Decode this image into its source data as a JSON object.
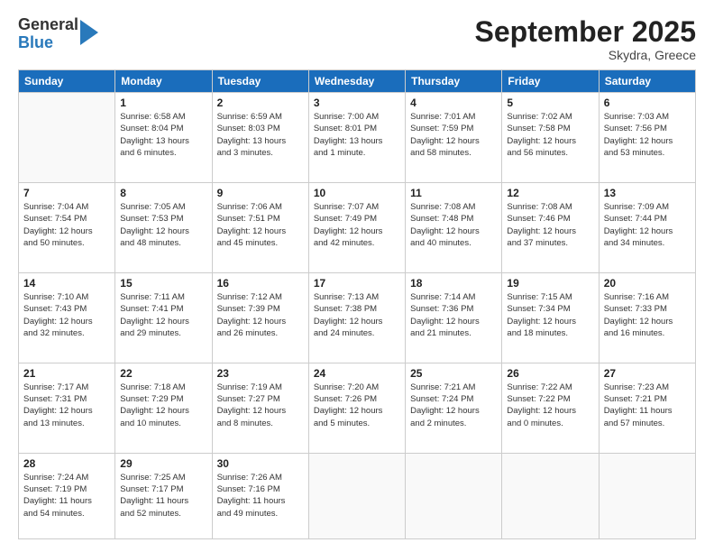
{
  "logo": {
    "general": "General",
    "blue": "Blue"
  },
  "title": "September 2025",
  "subtitle": "Skydra, Greece",
  "headers": [
    "Sunday",
    "Monday",
    "Tuesday",
    "Wednesday",
    "Thursday",
    "Friday",
    "Saturday"
  ],
  "weeks": [
    [
      {
        "day": "",
        "info": ""
      },
      {
        "day": "1",
        "info": "Sunrise: 6:58 AM\nSunset: 8:04 PM\nDaylight: 13 hours\nand 6 minutes."
      },
      {
        "day": "2",
        "info": "Sunrise: 6:59 AM\nSunset: 8:03 PM\nDaylight: 13 hours\nand 3 minutes."
      },
      {
        "day": "3",
        "info": "Sunrise: 7:00 AM\nSunset: 8:01 PM\nDaylight: 13 hours\nand 1 minute."
      },
      {
        "day": "4",
        "info": "Sunrise: 7:01 AM\nSunset: 7:59 PM\nDaylight: 12 hours\nand 58 minutes."
      },
      {
        "day": "5",
        "info": "Sunrise: 7:02 AM\nSunset: 7:58 PM\nDaylight: 12 hours\nand 56 minutes."
      },
      {
        "day": "6",
        "info": "Sunrise: 7:03 AM\nSunset: 7:56 PM\nDaylight: 12 hours\nand 53 minutes."
      }
    ],
    [
      {
        "day": "7",
        "info": "Sunrise: 7:04 AM\nSunset: 7:54 PM\nDaylight: 12 hours\nand 50 minutes."
      },
      {
        "day": "8",
        "info": "Sunrise: 7:05 AM\nSunset: 7:53 PM\nDaylight: 12 hours\nand 48 minutes."
      },
      {
        "day": "9",
        "info": "Sunrise: 7:06 AM\nSunset: 7:51 PM\nDaylight: 12 hours\nand 45 minutes."
      },
      {
        "day": "10",
        "info": "Sunrise: 7:07 AM\nSunset: 7:49 PM\nDaylight: 12 hours\nand 42 minutes."
      },
      {
        "day": "11",
        "info": "Sunrise: 7:08 AM\nSunset: 7:48 PM\nDaylight: 12 hours\nand 40 minutes."
      },
      {
        "day": "12",
        "info": "Sunrise: 7:08 AM\nSunset: 7:46 PM\nDaylight: 12 hours\nand 37 minutes."
      },
      {
        "day": "13",
        "info": "Sunrise: 7:09 AM\nSunset: 7:44 PM\nDaylight: 12 hours\nand 34 minutes."
      }
    ],
    [
      {
        "day": "14",
        "info": "Sunrise: 7:10 AM\nSunset: 7:43 PM\nDaylight: 12 hours\nand 32 minutes."
      },
      {
        "day": "15",
        "info": "Sunrise: 7:11 AM\nSunset: 7:41 PM\nDaylight: 12 hours\nand 29 minutes."
      },
      {
        "day": "16",
        "info": "Sunrise: 7:12 AM\nSunset: 7:39 PM\nDaylight: 12 hours\nand 26 minutes."
      },
      {
        "day": "17",
        "info": "Sunrise: 7:13 AM\nSunset: 7:38 PM\nDaylight: 12 hours\nand 24 minutes."
      },
      {
        "day": "18",
        "info": "Sunrise: 7:14 AM\nSunset: 7:36 PM\nDaylight: 12 hours\nand 21 minutes."
      },
      {
        "day": "19",
        "info": "Sunrise: 7:15 AM\nSunset: 7:34 PM\nDaylight: 12 hours\nand 18 minutes."
      },
      {
        "day": "20",
        "info": "Sunrise: 7:16 AM\nSunset: 7:33 PM\nDaylight: 12 hours\nand 16 minutes."
      }
    ],
    [
      {
        "day": "21",
        "info": "Sunrise: 7:17 AM\nSunset: 7:31 PM\nDaylight: 12 hours\nand 13 minutes."
      },
      {
        "day": "22",
        "info": "Sunrise: 7:18 AM\nSunset: 7:29 PM\nDaylight: 12 hours\nand 10 minutes."
      },
      {
        "day": "23",
        "info": "Sunrise: 7:19 AM\nSunset: 7:27 PM\nDaylight: 12 hours\nand 8 minutes."
      },
      {
        "day": "24",
        "info": "Sunrise: 7:20 AM\nSunset: 7:26 PM\nDaylight: 12 hours\nand 5 minutes."
      },
      {
        "day": "25",
        "info": "Sunrise: 7:21 AM\nSunset: 7:24 PM\nDaylight: 12 hours\nand 2 minutes."
      },
      {
        "day": "26",
        "info": "Sunrise: 7:22 AM\nSunset: 7:22 PM\nDaylight: 12 hours\nand 0 minutes."
      },
      {
        "day": "27",
        "info": "Sunrise: 7:23 AM\nSunset: 7:21 PM\nDaylight: 11 hours\nand 57 minutes."
      }
    ],
    [
      {
        "day": "28",
        "info": "Sunrise: 7:24 AM\nSunset: 7:19 PM\nDaylight: 11 hours\nand 54 minutes."
      },
      {
        "day": "29",
        "info": "Sunrise: 7:25 AM\nSunset: 7:17 PM\nDaylight: 11 hours\nand 52 minutes."
      },
      {
        "day": "30",
        "info": "Sunrise: 7:26 AM\nSunset: 7:16 PM\nDaylight: 11 hours\nand 49 minutes."
      },
      {
        "day": "",
        "info": ""
      },
      {
        "day": "",
        "info": ""
      },
      {
        "day": "",
        "info": ""
      },
      {
        "day": "",
        "info": ""
      }
    ]
  ]
}
